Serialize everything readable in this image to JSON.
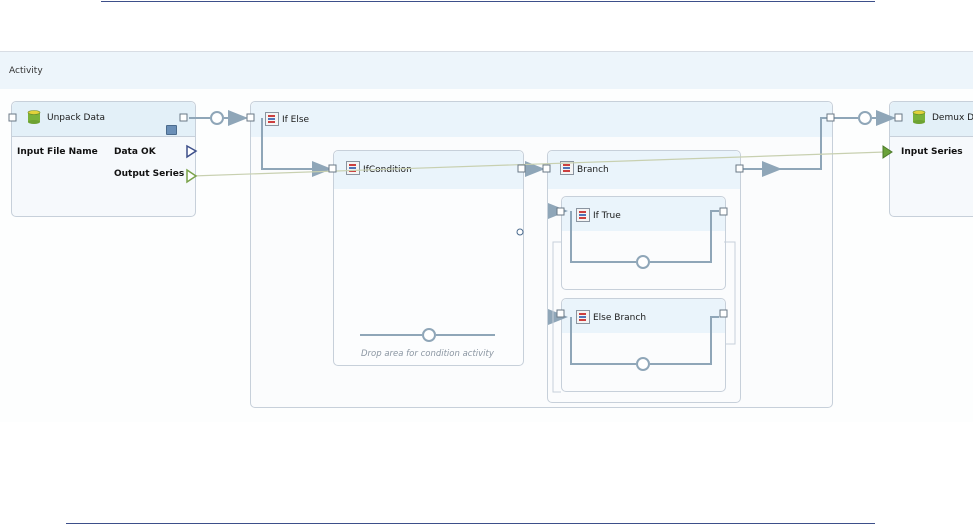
{
  "canvas": {
    "activity_label": "Activity"
  },
  "nodes": {
    "unpack": {
      "title": "Unpack Data",
      "input_label": "Input File Name",
      "outputs": [
        "Data OK",
        "Output Series"
      ]
    },
    "if_else": {
      "title": "If Else"
    },
    "if_condition": {
      "title": "IfCondition",
      "drop_hint": "Drop area for condition activity"
    },
    "branch": {
      "title": "Branch"
    },
    "if_true": {
      "title": "If True"
    },
    "else_branch": {
      "title": "Else Branch"
    },
    "demux": {
      "title": "Demux D",
      "input_label": "Input Series"
    }
  },
  "colors": {
    "header_bg": "#eaf4fb",
    "wire": "#8fa6b8",
    "data_wire": "#c8d0b0",
    "divider": "#3d4f8a"
  }
}
